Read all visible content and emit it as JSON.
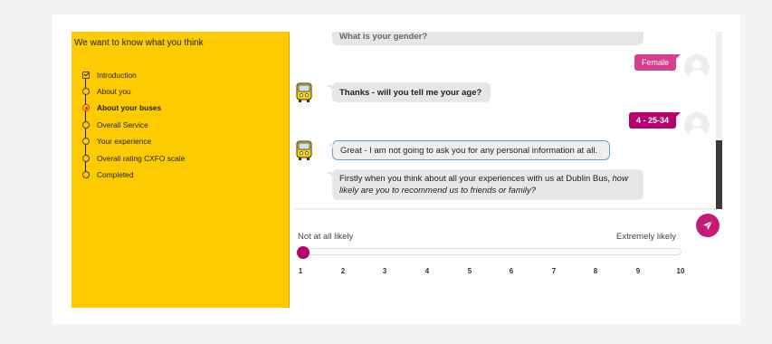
{
  "sidebar": {
    "title": "We want to know what you think",
    "steps": [
      {
        "label": "Introduction",
        "state": "done"
      },
      {
        "label": "About you",
        "state": "pending"
      },
      {
        "label": "About your buses",
        "state": "current"
      },
      {
        "label": "Overall Service",
        "state": "pending"
      },
      {
        "label": "Your experience",
        "state": "pending"
      },
      {
        "label": "Overall rating CXFO scale",
        "state": "pending"
      },
      {
        "label": "Completed",
        "state": "pending"
      }
    ]
  },
  "chat": {
    "partial_question": "What is your gender?",
    "answer_gender": "Female",
    "bot_age_question": "Thanks - will you tell me your age?",
    "answer_age": "4 - 25-34",
    "bot_privacy": "Great - I am not going to ask you for any personal information at all.",
    "bot_recommend_prefix": "Firstly when you think about all your experiences with us at Dublin Bus,",
    "bot_recommend_italic_1": "how",
    "bot_recommend_italic_2": "likely are you to recommend us to friends or family?"
  },
  "scale": {
    "min_label": "Not at all likely",
    "max_label": "Extremely likely",
    "ticks": [
      "1",
      "2",
      "3",
      "4",
      "5",
      "6",
      "7",
      "8",
      "9",
      "10"
    ],
    "value": 1
  },
  "colors": {
    "sidebar_bg": "#fecb00",
    "accent": "#b5006e",
    "bubble_pink": "#d63f8f"
  },
  "icons": {
    "send": "send-icon",
    "bot": "bus-bot-icon",
    "user": "user-avatar-icon"
  }
}
